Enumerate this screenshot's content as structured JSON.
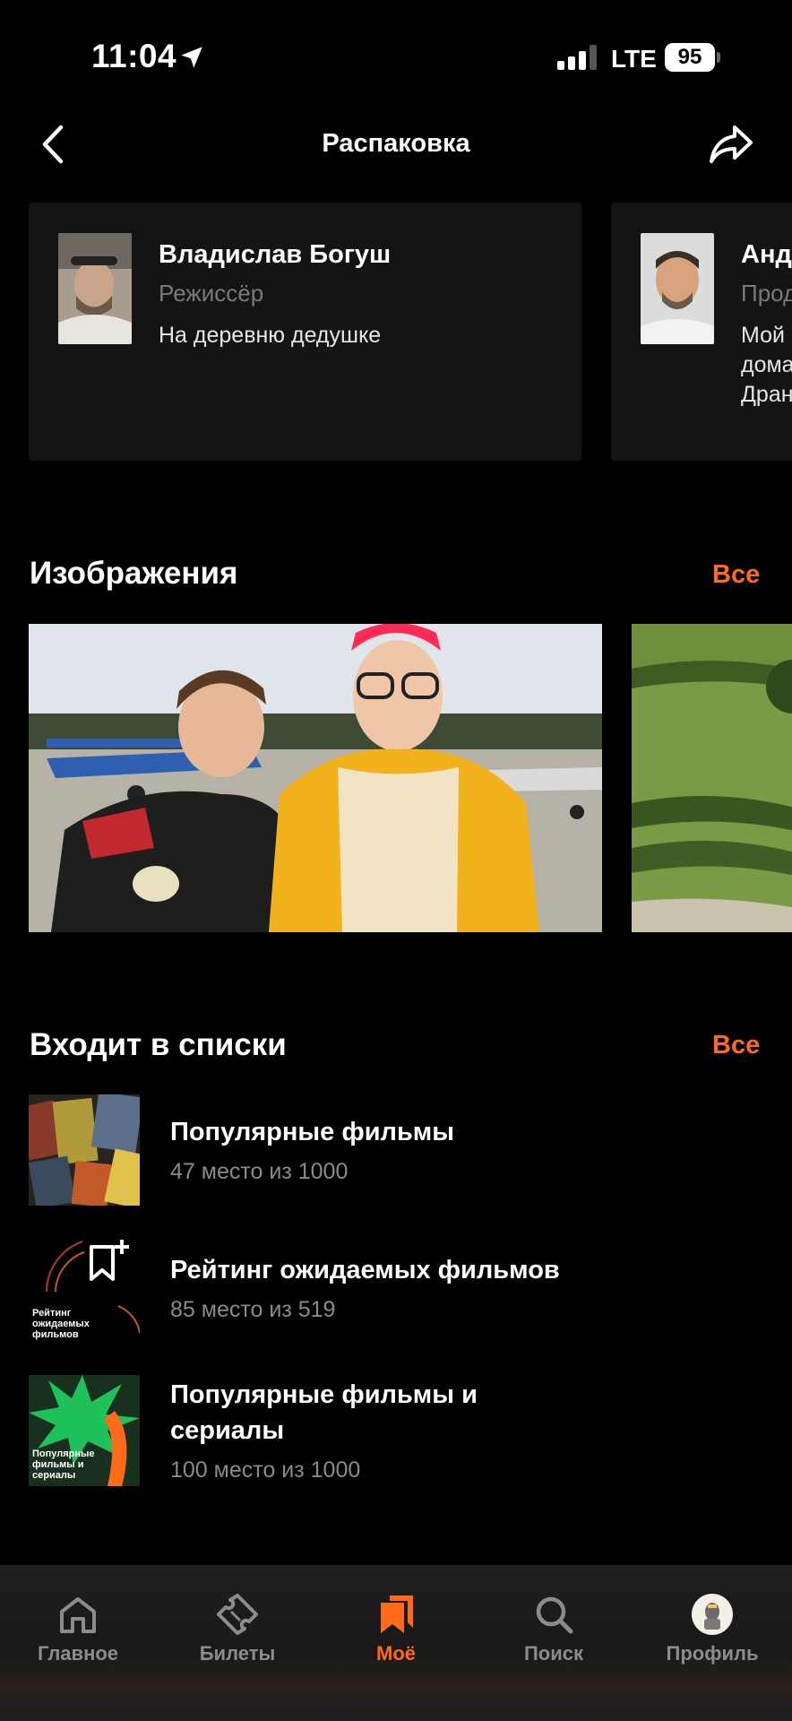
{
  "status_bar": {
    "time": "11:04",
    "network": "LTE",
    "battery": "95"
  },
  "header": {
    "title": "Распаковка"
  },
  "people": [
    {
      "name": "Владислав Богуш",
      "role": "Режиссёр",
      "work": "На деревню дедушке"
    },
    {
      "name": "Анд",
      "role": "Прод",
      "work": "Мой\nдома\nДран"
    }
  ],
  "images_section": {
    "title": "Изображения",
    "all_label": "Все"
  },
  "lists_section": {
    "title": "Входит в списки",
    "all_label": "Все",
    "items": [
      {
        "title": "Популярные фильмы",
        "subtitle": "47 место из 1000",
        "thumb_text": ""
      },
      {
        "title": "Рейтинг ожидаемых фильмов",
        "subtitle": "85 место из 519",
        "thumb_text": "Рейтинг ожидаемых фильмов"
      },
      {
        "title": "Популярные фильмы и сериалы",
        "subtitle": "100 место из 1000",
        "thumb_text": "Популярные фильмы и сериалы"
      }
    ]
  },
  "tab_bar": {
    "tabs": [
      {
        "label": "Главное",
        "icon": "home-icon"
      },
      {
        "label": "Билеты",
        "icon": "ticket-icon"
      },
      {
        "label": "Моё",
        "icon": "bookmarks-icon",
        "active": true
      },
      {
        "label": "Поиск",
        "icon": "search-icon"
      },
      {
        "label": "Профиль",
        "icon": "avatar"
      }
    ]
  },
  "colors": {
    "accent": "#ff6a1a",
    "background": "#000000",
    "card": "#141414",
    "muted": "#8a8a8a"
  }
}
